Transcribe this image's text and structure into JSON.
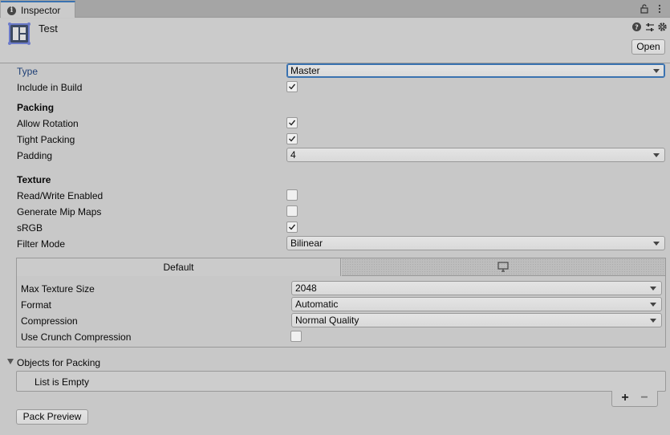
{
  "tab": {
    "title": "Inspector"
  },
  "header": {
    "asset_name": "Test",
    "open_label": "Open"
  },
  "fields": {
    "type": {
      "label": "Type",
      "value": "Master"
    },
    "include_in_build": {
      "label": "Include in Build",
      "checked": true
    },
    "packing_header": "Packing",
    "allow_rotation": {
      "label": "Allow Rotation",
      "checked": true
    },
    "tight_packing": {
      "label": "Tight Packing",
      "checked": true
    },
    "padding": {
      "label": "Padding",
      "value": "4"
    },
    "texture_header": "Texture",
    "read_write": {
      "label": "Read/Write Enabled",
      "checked": false
    },
    "mip_maps": {
      "label": "Generate Mip Maps",
      "checked": false
    },
    "srgb": {
      "label": "sRGB",
      "checked": true
    },
    "filter_mode": {
      "label": "Filter Mode",
      "value": "Bilinear"
    }
  },
  "platform": {
    "default_tab": "Default",
    "standalone_icon": "monitor-icon",
    "max_texture_size": {
      "label": "Max Texture Size",
      "value": "2048"
    },
    "format": {
      "label": "Format",
      "value": "Automatic"
    },
    "compression": {
      "label": "Compression",
      "value": "Normal Quality"
    },
    "crunch": {
      "label": "Use Crunch Compression",
      "checked": false
    }
  },
  "objects": {
    "label": "Objects for Packing",
    "empty_text": "List is Empty",
    "add_label": "+",
    "remove_label": "−"
  },
  "footer": {
    "pack_preview_label": "Pack Preview"
  },
  "colors": {
    "accent": "#3a72b0",
    "type_label": "#1e3f76",
    "background": "#c8c8c8"
  }
}
